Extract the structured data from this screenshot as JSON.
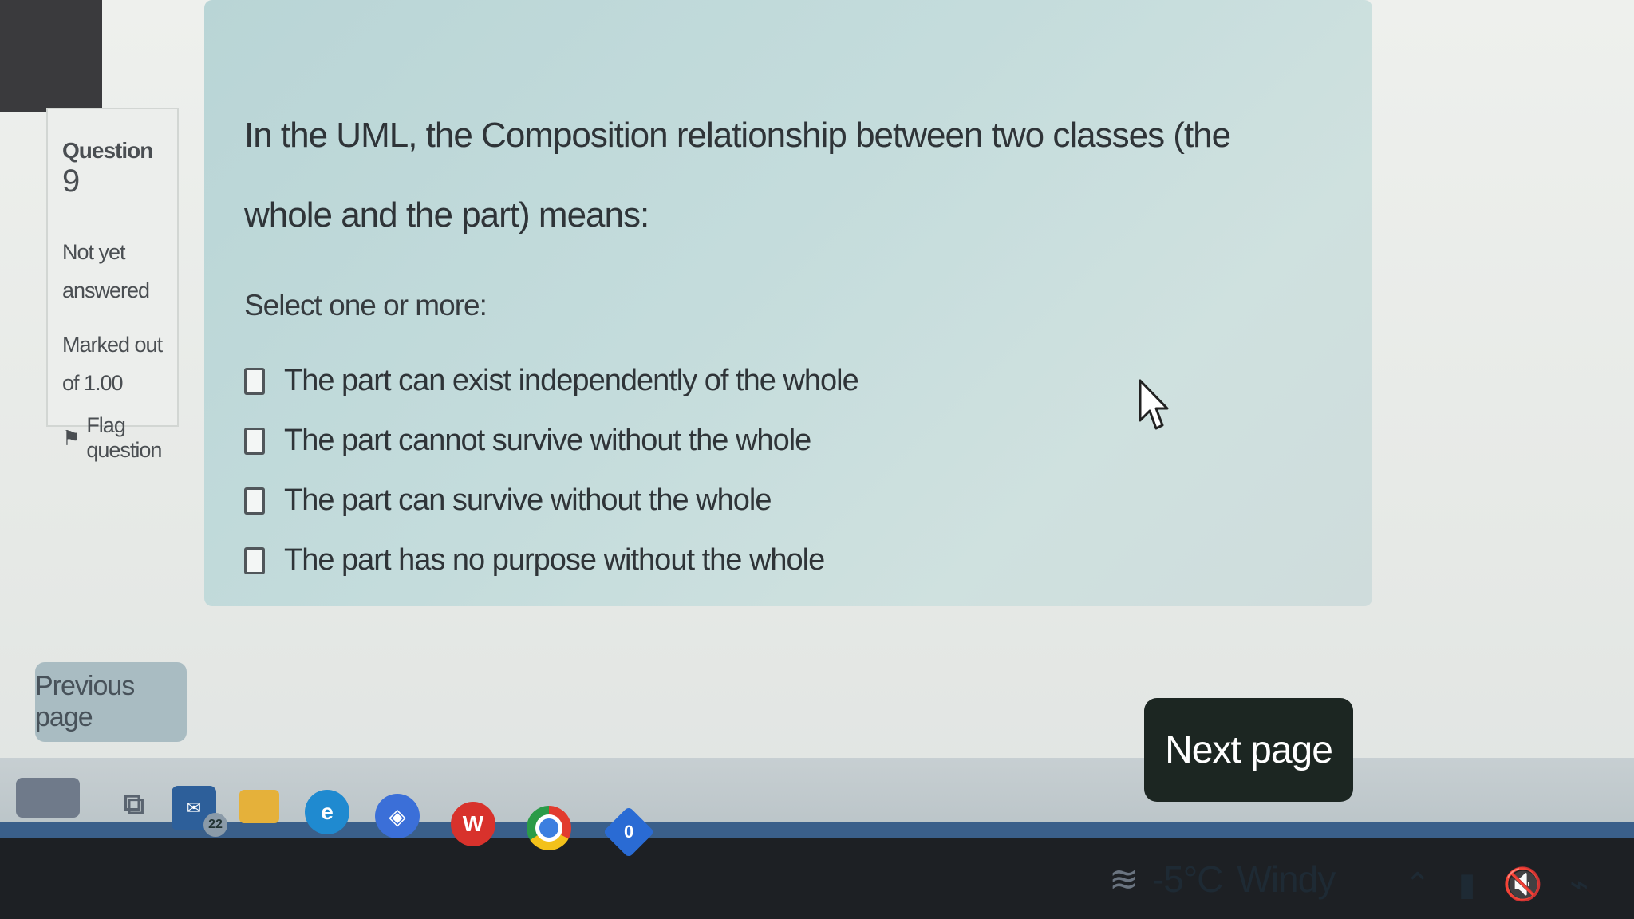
{
  "question_info": {
    "question_label": "Question",
    "question_number": "9",
    "status": "Not yet answered",
    "marked_out_of": "Marked out of 1.00",
    "flag_label": "Flag question"
  },
  "question": {
    "text": "In the UML, the Composition relationship between two classes (the whole and the part) means:",
    "instruction": "Select one or more:",
    "options": [
      {
        "label": "The part can exist independently of the whole",
        "checked": false
      },
      {
        "label": "The part cannot survive without the whole",
        "checked": false
      },
      {
        "label": "The part can survive without the whole",
        "checked": false
      },
      {
        "label": "The part has no purpose without the whole",
        "checked": false
      }
    ]
  },
  "navigation": {
    "previous_label": "Previous page",
    "next_label": "Next page"
  },
  "taskbar": {
    "mail_badge": "22",
    "wps_glyph": "W",
    "diamond_glyph": "0",
    "weather_temp": "-5°C",
    "weather_condition": "Windy",
    "icons": [
      "start-icon",
      "task-view-icon",
      "mail-icon",
      "file-explorer-icon",
      "edge-icon",
      "copilot-icon",
      "wps-office-icon",
      "chrome-icon",
      "app-diamond-icon"
    ]
  },
  "colors": {
    "panel": "#c4dcdc",
    "next_button": "#1c2622",
    "previous_button": "#a9bcc2"
  }
}
